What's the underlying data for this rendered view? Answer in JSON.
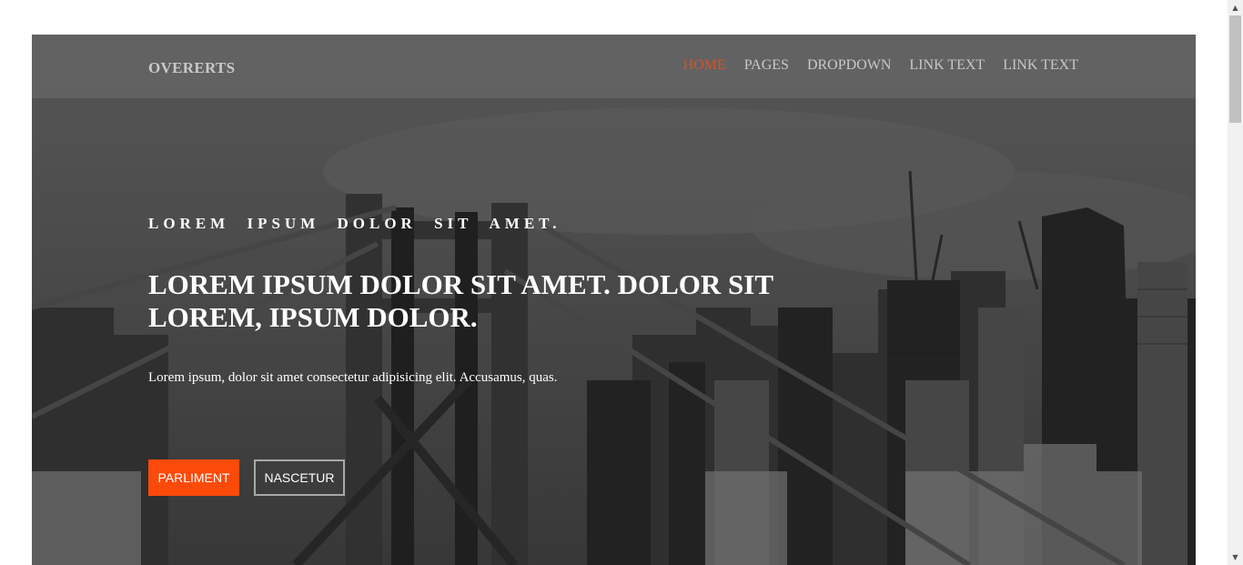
{
  "navbar": {
    "brand": "OVERERTS",
    "links": [
      {
        "label": "HOME",
        "active": true
      },
      {
        "label": "PAGES",
        "active": false
      },
      {
        "label": "DROPDOWN",
        "active": false
      },
      {
        "label": "LINK TEXT",
        "active": false
      },
      {
        "label": "LINK TEXT",
        "active": false
      }
    ]
  },
  "hero": {
    "eyebrow": "LOREM IPSUM DOLOR SIT AMET.",
    "headline": "LOREM IPSUM DOLOR SIT AMET. DOLOR SIT LOREM, IPSUM DOLOR.",
    "lead": "Lorem ipsum, dolor sit amet consectetur adipisicing elit. Accusamus, quas.",
    "primary_button": "PARLIMENT",
    "secondary_button": "NASCETUR",
    "background": "city-skyline-bridge-photo"
  },
  "colors": {
    "accent": "#fc4a0a",
    "nav_active": "#d7522a",
    "nav_text": "#c8c8c8"
  },
  "icons": {
    "scroll_up": "▲",
    "scroll_down": "▼"
  }
}
